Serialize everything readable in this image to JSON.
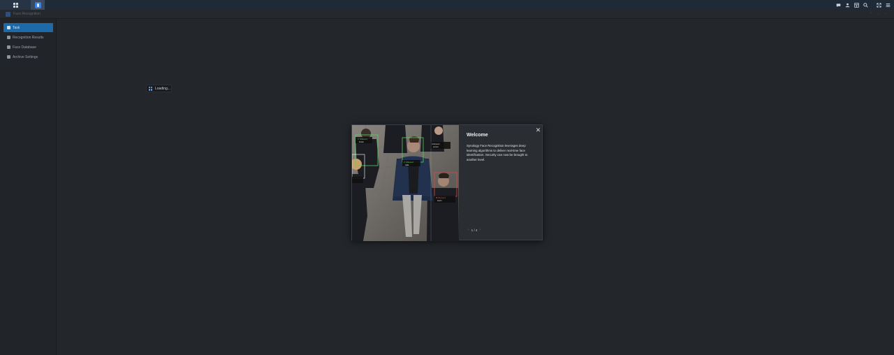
{
  "window": {
    "title": "Face Recognition"
  },
  "sidebar": {
    "items": [
      {
        "label": "Task",
        "active": true,
        "icon": "task-icon"
      },
      {
        "label": "Recognition Results",
        "active": false,
        "icon": "results-icon"
      },
      {
        "label": "Face Database",
        "active": false,
        "icon": "folder-icon"
      },
      {
        "label": "Archive Settings",
        "active": false,
        "icon": "archive-icon"
      }
    ]
  },
  "loading": {
    "label": "Loading..."
  },
  "modal": {
    "title": "Welcome",
    "description": "Synology Face Recognition leverages deep learning algorithms to deliver real-time face identification. Security can now be brought to another level.",
    "pager": {
      "current": 1,
      "total": 4,
      "text": "1 / 4"
    }
  },
  "colors": {
    "accent": "#1c6aa8",
    "background": "#23262b",
    "taskbar": "#1e2a38"
  }
}
